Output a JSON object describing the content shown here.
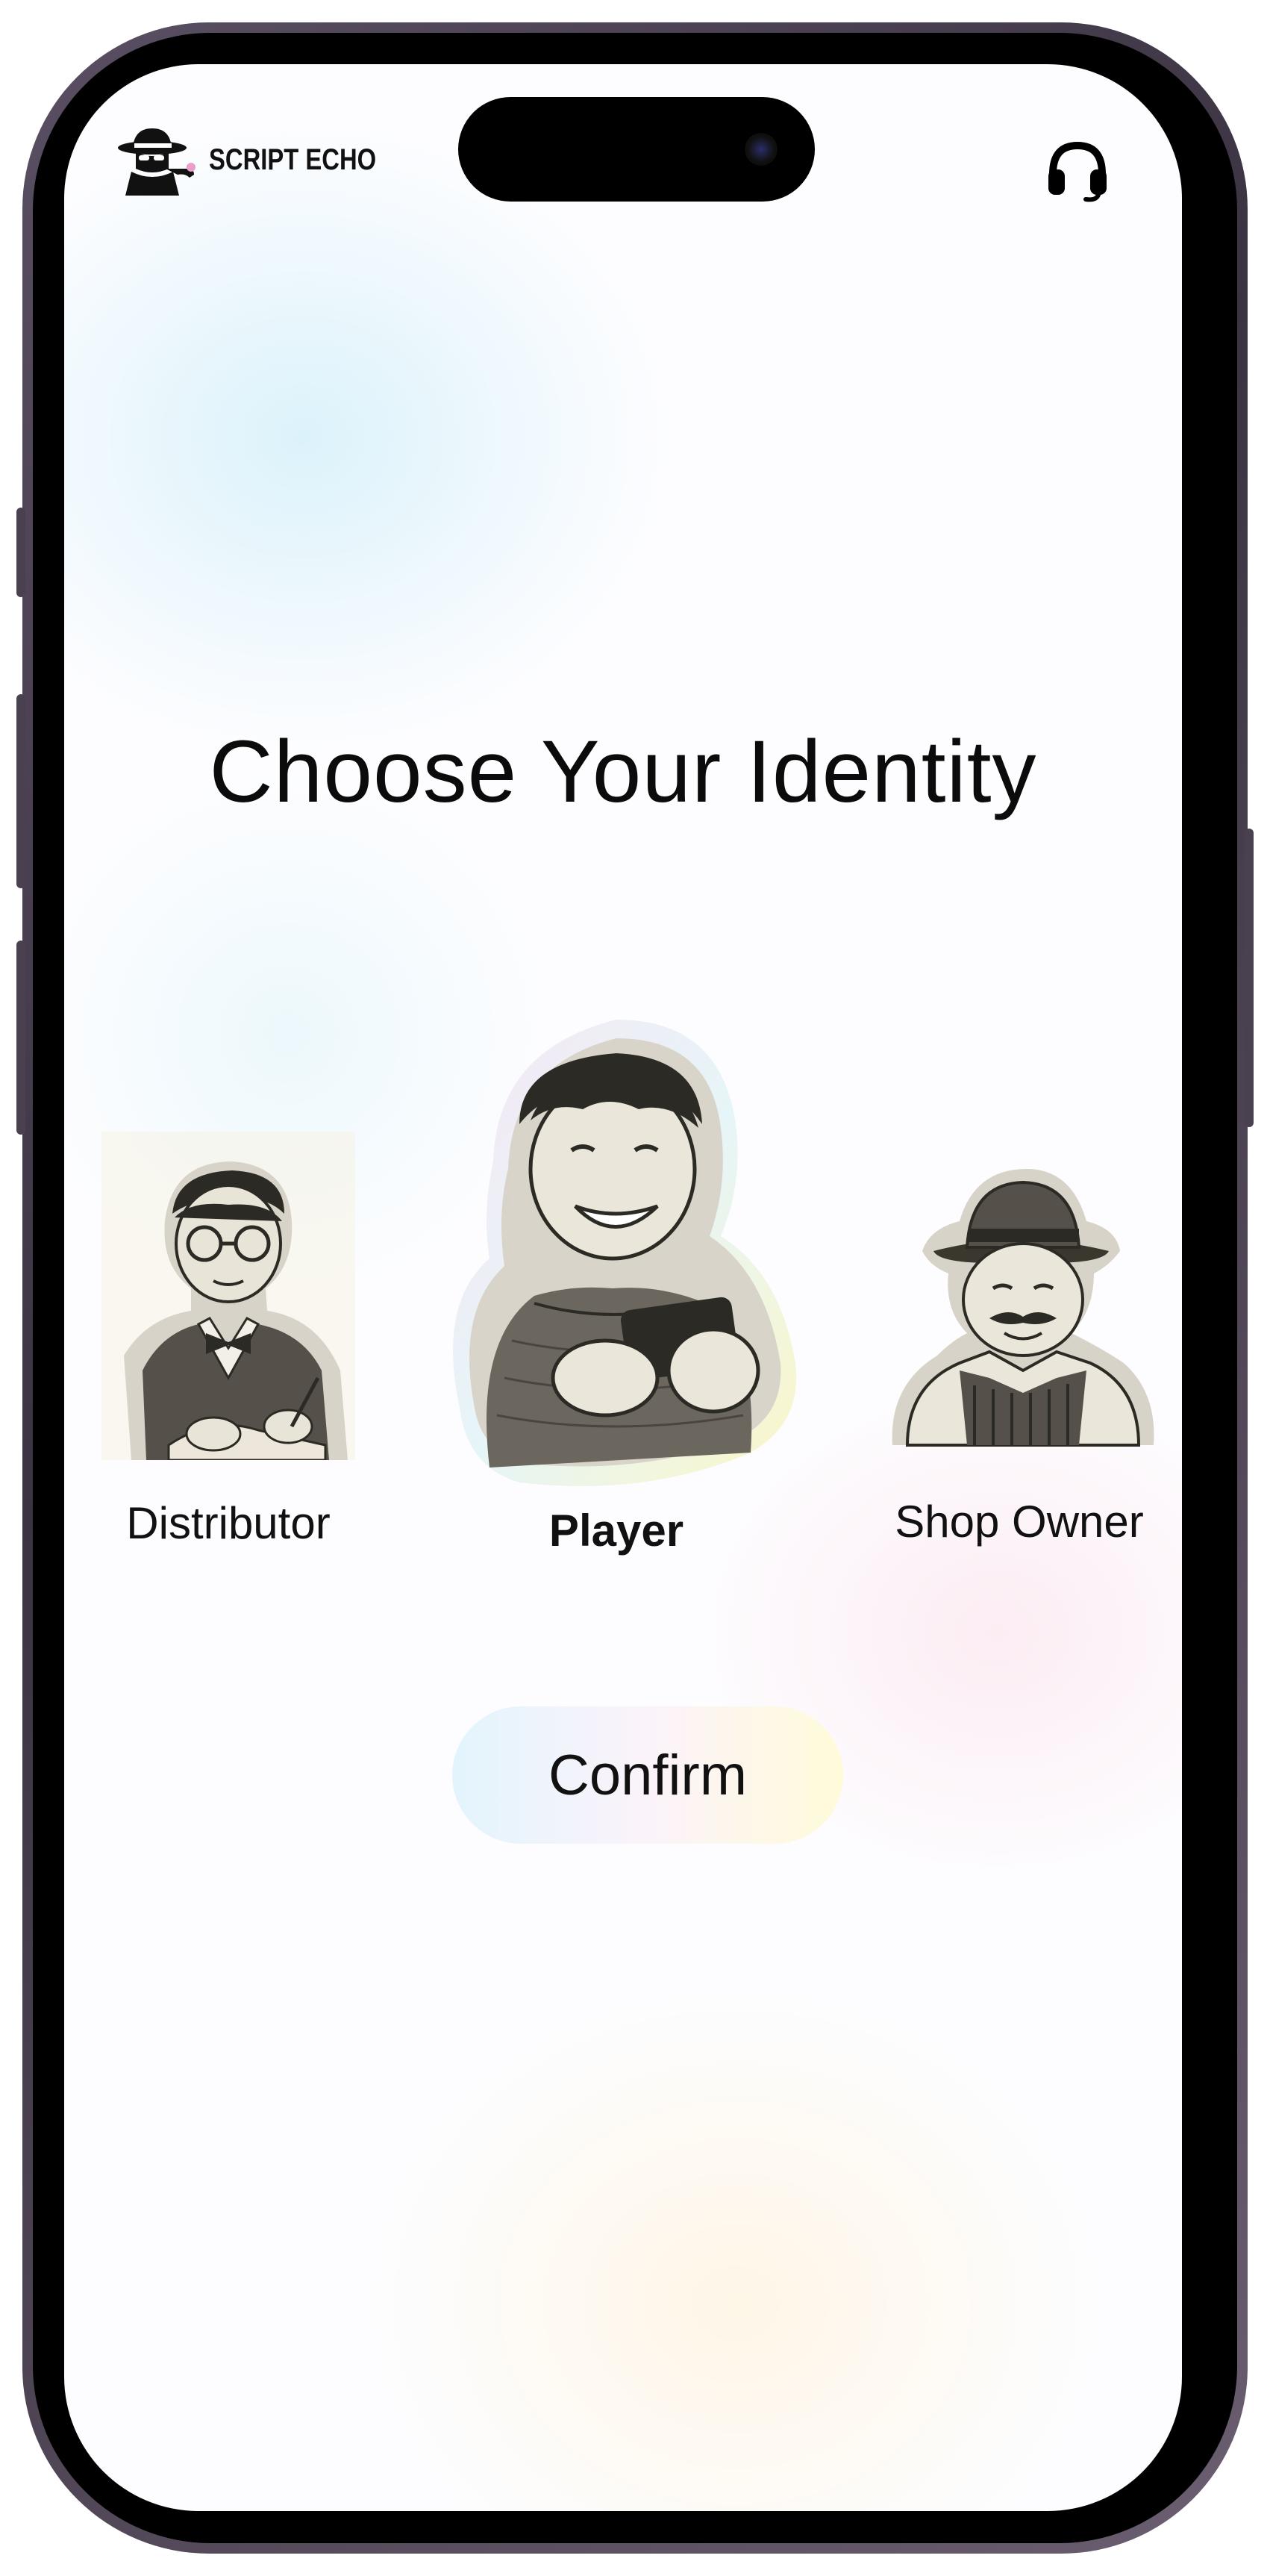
{
  "app": {
    "brand_name": "SCRIPT ECHO",
    "logo_icon": "detective-logo-icon",
    "support_icon": "headset-icon"
  },
  "screen": {
    "title": "Choose Your Identity",
    "roles": [
      {
        "label": "Distributor",
        "icon": "distributor-portrait",
        "selected": false
      },
      {
        "label": "Player",
        "icon": "player-portrait",
        "selected": true
      },
      {
        "label": "Shop Owner",
        "icon": "shop-owner-portrait",
        "selected": false
      }
    ],
    "confirm_label": "Confirm"
  },
  "colors": {
    "text": "#111111",
    "confirm_gradient": [
      "#e3f4fd",
      "#fbf3fa",
      "#fffbd9"
    ],
    "frame": "#3b3342"
  }
}
